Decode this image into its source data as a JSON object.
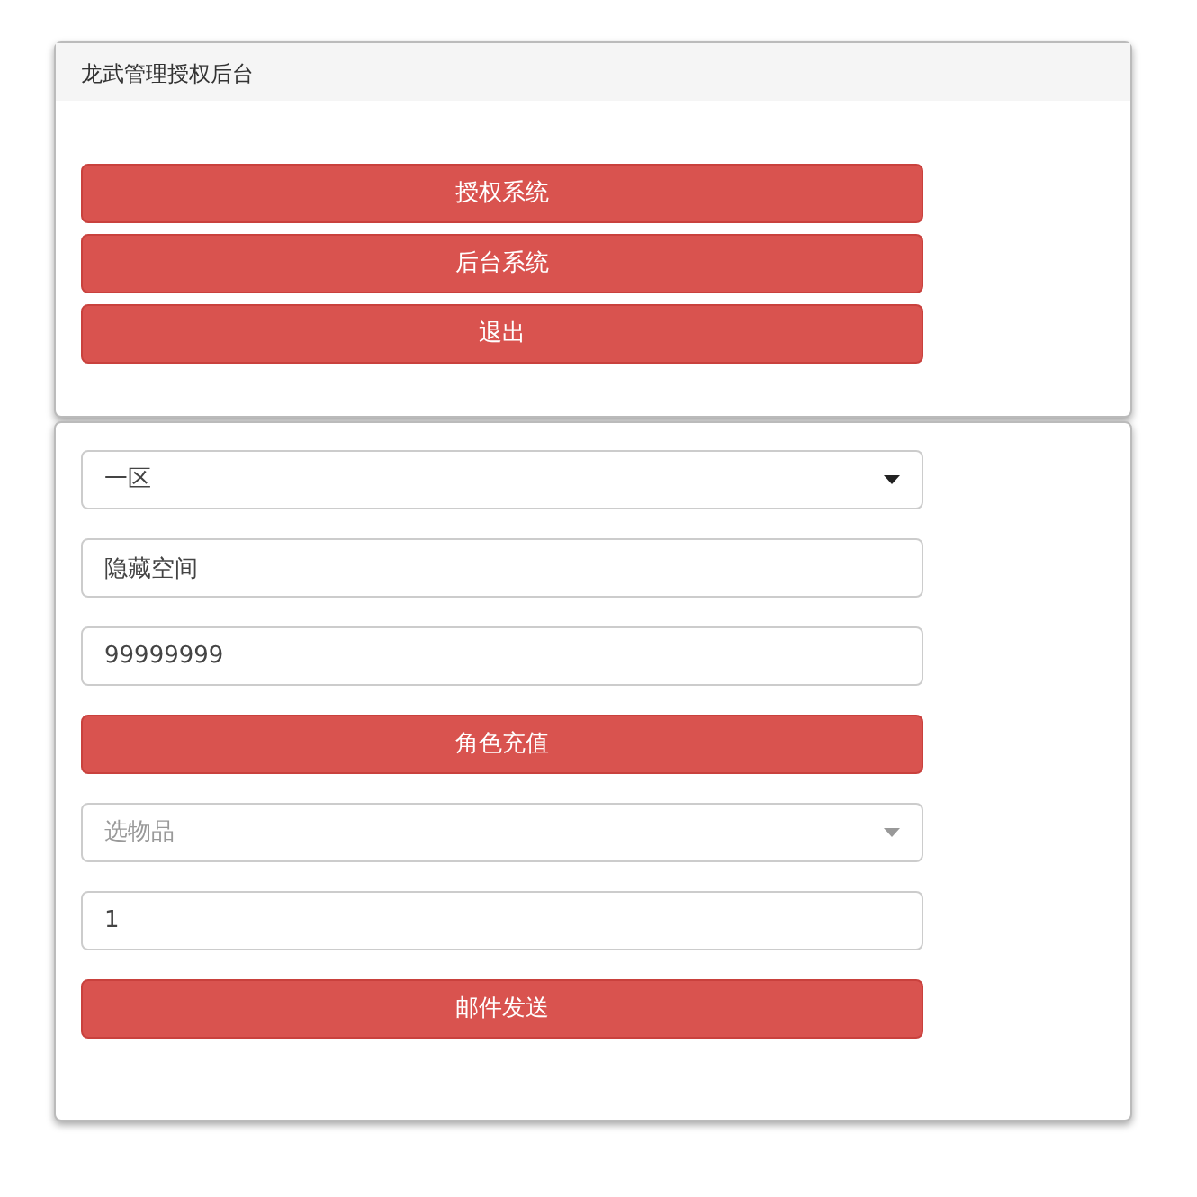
{
  "header": {
    "title": "龙武管理授权后台"
  },
  "menu_buttons": [
    {
      "label": "授权系统"
    },
    {
      "label": "后台系统"
    },
    {
      "label": "退出"
    }
  ],
  "form_items": [
    {
      "kind": "dropdown",
      "value": "一区"
    },
    {
      "kind": "input",
      "value": "隐藏空间"
    },
    {
      "kind": "input",
      "value": "99999999"
    },
    {
      "kind": "button",
      "label": "角色充值"
    },
    {
      "kind": "dropdown",
      "placeholder": "选物品"
    },
    {
      "kind": "input",
      "value": "1"
    },
    {
      "kind": "button",
      "label": "邮件发送"
    }
  ]
}
